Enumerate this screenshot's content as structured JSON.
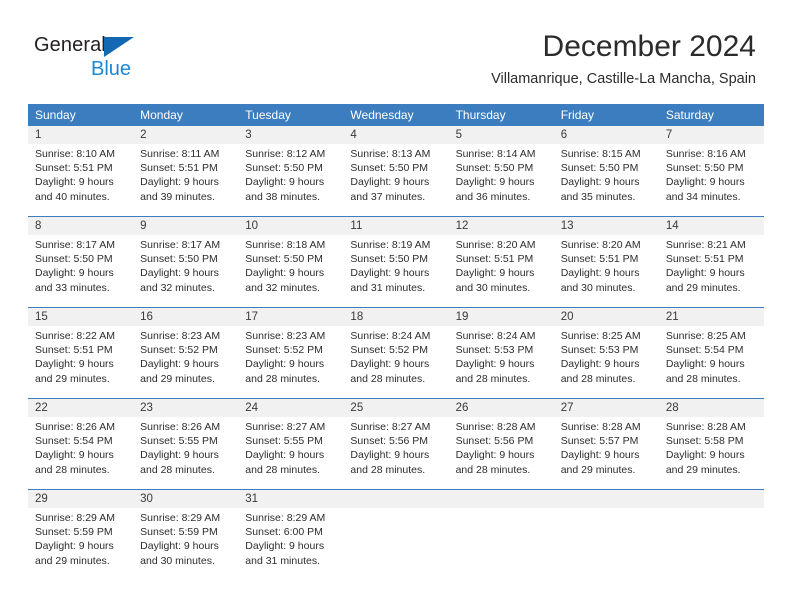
{
  "brand": {
    "name_part1": "General",
    "name_part2": "Blue",
    "triangle_color": "#1268b3",
    "blue_color": "#1b88d4"
  },
  "header": {
    "title": "December 2024",
    "location": "Villamanrique, Castille-La Mancha, Spain"
  },
  "theme": {
    "header_blue": "#3c7dc0",
    "day_band_gray": "#f1f1f1",
    "text": "#2d2d2d"
  },
  "weekdays": [
    "Sunday",
    "Monday",
    "Tuesday",
    "Wednesday",
    "Thursday",
    "Friday",
    "Saturday"
  ],
  "weeks": [
    {
      "days": [
        {
          "n": "1",
          "lines": [
            "Sunrise: 8:10 AM",
            "Sunset: 5:51 PM",
            "Daylight: 9 hours",
            "and 40 minutes."
          ]
        },
        {
          "n": "2",
          "lines": [
            "Sunrise: 8:11 AM",
            "Sunset: 5:51 PM",
            "Daylight: 9 hours",
            "and 39 minutes."
          ]
        },
        {
          "n": "3",
          "lines": [
            "Sunrise: 8:12 AM",
            "Sunset: 5:50 PM",
            "Daylight: 9 hours",
            "and 38 minutes."
          ]
        },
        {
          "n": "4",
          "lines": [
            "Sunrise: 8:13 AM",
            "Sunset: 5:50 PM",
            "Daylight: 9 hours",
            "and 37 minutes."
          ]
        },
        {
          "n": "5",
          "lines": [
            "Sunrise: 8:14 AM",
            "Sunset: 5:50 PM",
            "Daylight: 9 hours",
            "and 36 minutes."
          ]
        },
        {
          "n": "6",
          "lines": [
            "Sunrise: 8:15 AM",
            "Sunset: 5:50 PM",
            "Daylight: 9 hours",
            "and 35 minutes."
          ]
        },
        {
          "n": "7",
          "lines": [
            "Sunrise: 8:16 AM",
            "Sunset: 5:50 PM",
            "Daylight: 9 hours",
            "and 34 minutes."
          ]
        }
      ]
    },
    {
      "days": [
        {
          "n": "8",
          "lines": [
            "Sunrise: 8:17 AM",
            "Sunset: 5:50 PM",
            "Daylight: 9 hours",
            "and 33 minutes."
          ]
        },
        {
          "n": "9",
          "lines": [
            "Sunrise: 8:17 AM",
            "Sunset: 5:50 PM",
            "Daylight: 9 hours",
            "and 32 minutes."
          ]
        },
        {
          "n": "10",
          "lines": [
            "Sunrise: 8:18 AM",
            "Sunset: 5:50 PM",
            "Daylight: 9 hours",
            "and 32 minutes."
          ]
        },
        {
          "n": "11",
          "lines": [
            "Sunrise: 8:19 AM",
            "Sunset: 5:50 PM",
            "Daylight: 9 hours",
            "and 31 minutes."
          ]
        },
        {
          "n": "12",
          "lines": [
            "Sunrise: 8:20 AM",
            "Sunset: 5:51 PM",
            "Daylight: 9 hours",
            "and 30 minutes."
          ]
        },
        {
          "n": "13",
          "lines": [
            "Sunrise: 8:20 AM",
            "Sunset: 5:51 PM",
            "Daylight: 9 hours",
            "and 30 minutes."
          ]
        },
        {
          "n": "14",
          "lines": [
            "Sunrise: 8:21 AM",
            "Sunset: 5:51 PM",
            "Daylight: 9 hours",
            "and 29 minutes."
          ]
        }
      ]
    },
    {
      "days": [
        {
          "n": "15",
          "lines": [
            "Sunrise: 8:22 AM",
            "Sunset: 5:51 PM",
            "Daylight: 9 hours",
            "and 29 minutes."
          ]
        },
        {
          "n": "16",
          "lines": [
            "Sunrise: 8:23 AM",
            "Sunset: 5:52 PM",
            "Daylight: 9 hours",
            "and 29 minutes."
          ]
        },
        {
          "n": "17",
          "lines": [
            "Sunrise: 8:23 AM",
            "Sunset: 5:52 PM",
            "Daylight: 9 hours",
            "and 28 minutes."
          ]
        },
        {
          "n": "18",
          "lines": [
            "Sunrise: 8:24 AM",
            "Sunset: 5:52 PM",
            "Daylight: 9 hours",
            "and 28 minutes."
          ]
        },
        {
          "n": "19",
          "lines": [
            "Sunrise: 8:24 AM",
            "Sunset: 5:53 PM",
            "Daylight: 9 hours",
            "and 28 minutes."
          ]
        },
        {
          "n": "20",
          "lines": [
            "Sunrise: 8:25 AM",
            "Sunset: 5:53 PM",
            "Daylight: 9 hours",
            "and 28 minutes."
          ]
        },
        {
          "n": "21",
          "lines": [
            "Sunrise: 8:25 AM",
            "Sunset: 5:54 PM",
            "Daylight: 9 hours",
            "and 28 minutes."
          ]
        }
      ]
    },
    {
      "days": [
        {
          "n": "22",
          "lines": [
            "Sunrise: 8:26 AM",
            "Sunset: 5:54 PM",
            "Daylight: 9 hours",
            "and 28 minutes."
          ]
        },
        {
          "n": "23",
          "lines": [
            "Sunrise: 8:26 AM",
            "Sunset: 5:55 PM",
            "Daylight: 9 hours",
            "and 28 minutes."
          ]
        },
        {
          "n": "24",
          "lines": [
            "Sunrise: 8:27 AM",
            "Sunset: 5:55 PM",
            "Daylight: 9 hours",
            "and 28 minutes."
          ]
        },
        {
          "n": "25",
          "lines": [
            "Sunrise: 8:27 AM",
            "Sunset: 5:56 PM",
            "Daylight: 9 hours",
            "and 28 minutes."
          ]
        },
        {
          "n": "26",
          "lines": [
            "Sunrise: 8:28 AM",
            "Sunset: 5:56 PM",
            "Daylight: 9 hours",
            "and 28 minutes."
          ]
        },
        {
          "n": "27",
          "lines": [
            "Sunrise: 8:28 AM",
            "Sunset: 5:57 PM",
            "Daylight: 9 hours",
            "and 29 minutes."
          ]
        },
        {
          "n": "28",
          "lines": [
            "Sunrise: 8:28 AM",
            "Sunset: 5:58 PM",
            "Daylight: 9 hours",
            "and 29 minutes."
          ]
        }
      ]
    },
    {
      "days": [
        {
          "n": "29",
          "lines": [
            "Sunrise: 8:29 AM",
            "Sunset: 5:59 PM",
            "Daylight: 9 hours",
            "and 29 minutes."
          ]
        },
        {
          "n": "30",
          "lines": [
            "Sunrise: 8:29 AM",
            "Sunset: 5:59 PM",
            "Daylight: 9 hours",
            "and 30 minutes."
          ]
        },
        {
          "n": "31",
          "lines": [
            "Sunrise: 8:29 AM",
            "Sunset: 6:00 PM",
            "Daylight: 9 hours",
            "and 31 minutes."
          ]
        },
        {
          "n": "",
          "lines": []
        },
        {
          "n": "",
          "lines": []
        },
        {
          "n": "",
          "lines": []
        },
        {
          "n": "",
          "lines": []
        }
      ]
    }
  ]
}
